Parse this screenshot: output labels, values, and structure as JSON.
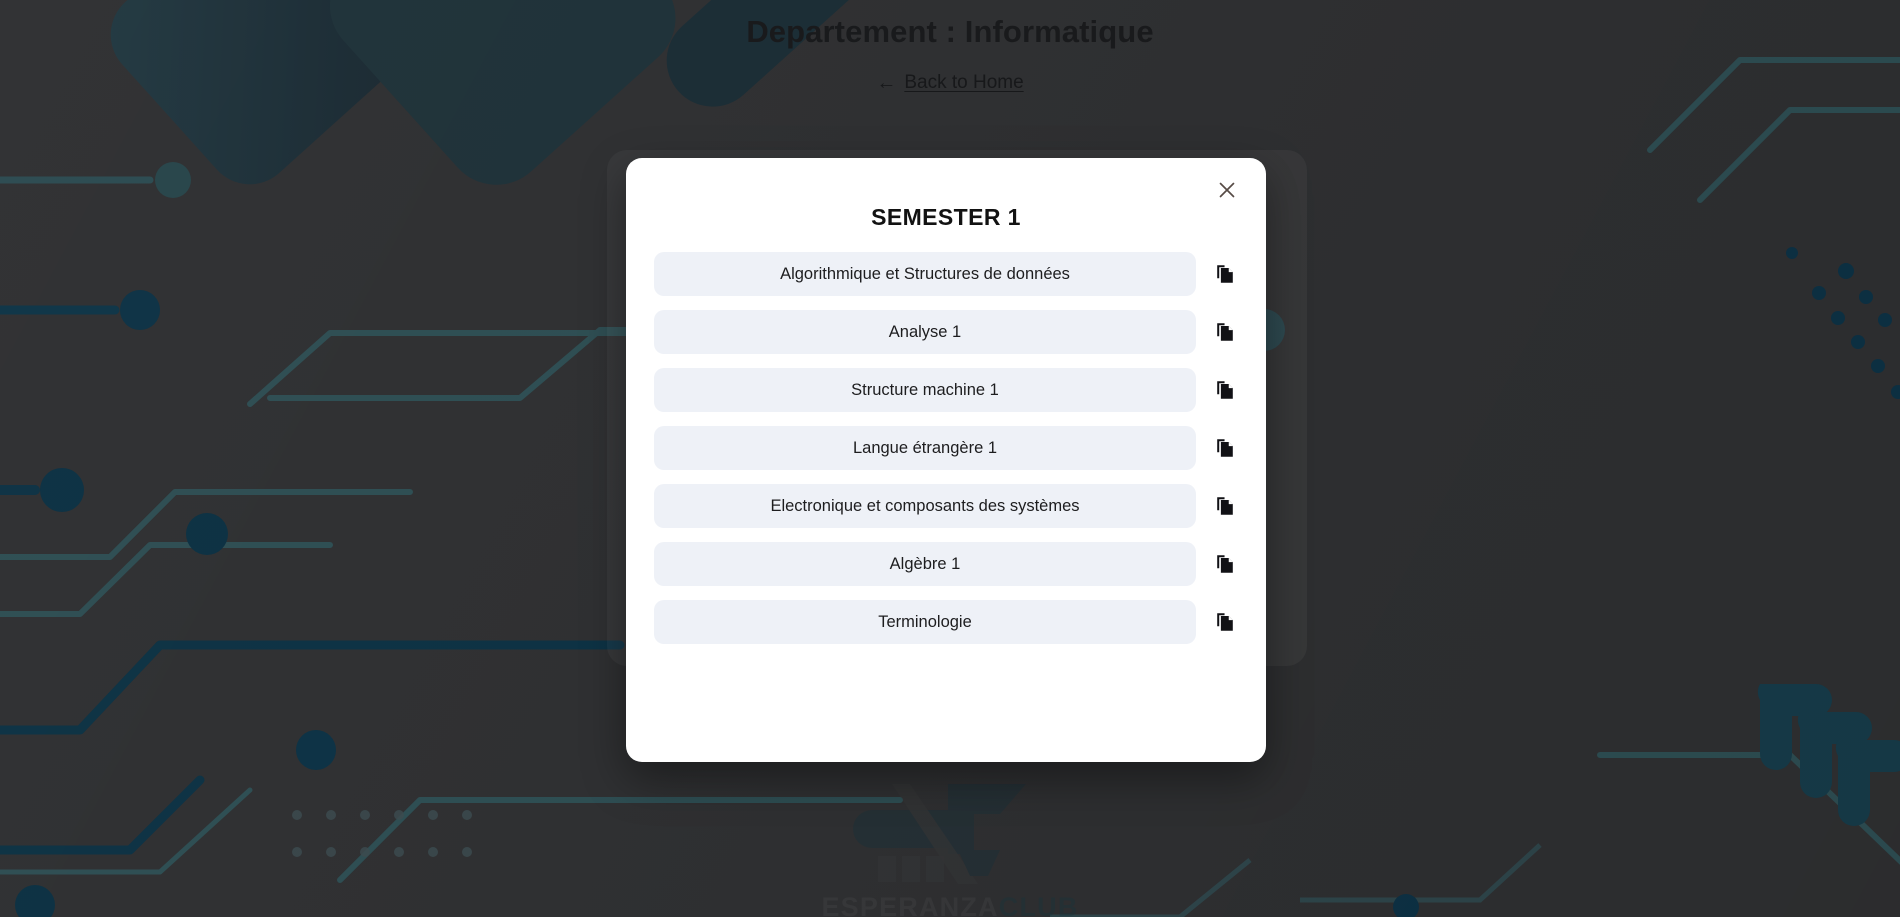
{
  "header": {
    "title": "Departement : Informatique",
    "back_arrow": "←",
    "back_label": "Back to Home"
  },
  "modal": {
    "title": "SEMESTER 1",
    "close_icon": "close-icon",
    "close_label": "×",
    "copy_icon": "copy-icon",
    "courses": [
      {
        "name": "Algorithmique et Structures de données"
      },
      {
        "name": "Analyse 1"
      },
      {
        "name": "Structure machine 1"
      },
      {
        "name": "Langue étrangère 1"
      },
      {
        "name": "Electronique et composants des systèmes"
      },
      {
        "name": "Algèbre 1"
      },
      {
        "name": "Terminologie"
      }
    ]
  },
  "branding": {
    "word_1": "ESPERANZA",
    "word_2": "CLUB"
  },
  "colors": {
    "page_background": "#2e2f31",
    "circuit_accent": "#0d3040",
    "circuit_accent_soft": "#1d4453",
    "modal_background": "#ffffff",
    "pill_background": "#eef1f7",
    "text_primary": "#1d1d1f",
    "close_icon": "#574b46",
    "brand_accent": "#11353f"
  }
}
